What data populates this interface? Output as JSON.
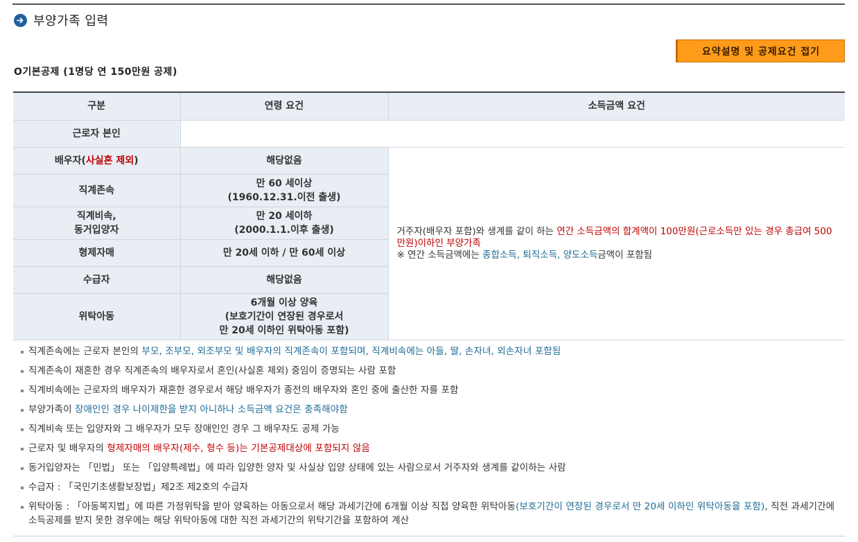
{
  "header": {
    "title": "부양가족 입력",
    "icon": "arrow-circle-icon"
  },
  "fold_button": {
    "label": "요약설명 및 공제요건 접기"
  },
  "section_title": "O기본공제 (1명당 연 150만원 공제)",
  "table": {
    "headers": [
      "구분",
      "연령 요건",
      "소득금액 요건"
    ],
    "rows": [
      {
        "label": "근로자 본인",
        "condition": ""
      },
      {
        "label_a": "배우자(",
        "label_b": "사실혼 제외",
        "label_c": ")",
        "condition": "해당없음"
      },
      {
        "label": "직계존속",
        "condition_1": "만 60 세이상",
        "condition_2": "(1960.12.31.이전 출생)"
      },
      {
        "label_1": "직계비속,",
        "label_2": "동거입양자",
        "condition_1": "만 20 세이하",
        "condition_2": "(2000.1.1.이후 출생)"
      },
      {
        "label": "형제자매",
        "condition": "만 20세 이하 / 만 60세 이상"
      },
      {
        "label": "수급자",
        "condition": "해당없음"
      },
      {
        "label": "위탁아동",
        "condition_1": "6개월 이상 양육",
        "condition_2": "(보호기간이 연장된 경우로서",
        "condition_3": "만 20세 이하인 위탁아동 포함)"
      }
    ],
    "income": {
      "part1": "거주자(배우자 포함)와 생계를 같이 하는 ",
      "part2": "연간 소득금액의 합계액이 100만원(근로소득만 있는 경우 총급여 500만원)이하인 부양가족",
      "part3": "※ 연간 소득금액에는 ",
      "part4": "종합소득, 퇴직소득, 양도소득",
      "part5": "금액이 포함됨"
    }
  },
  "notes": [
    {
      "a": "직계존속에는 근로자 본인의 ",
      "b": "부모, 조부모, 외조부모 및 배우자의 직계존속이 포함되며, 직계비속에는 아들, 딸, 손자녀, 외손자녀 포함됨"
    },
    {
      "a": "직계존속이 재혼한 경우 직계존속의 배우자로서 혼인(사실혼 제외) 중임이 증명되는 사람 포함"
    },
    {
      "a": "직계비속에는 근로자의 배우자가 재혼한 경우로서 해당 배우자가 종전의 배우자와 혼인 중에 출산한 자를 포함"
    },
    {
      "a": "부양가족이 ",
      "b": "장애인인 경우 나이제한을 받지 아니하나 소득금액 요건은 충족해야함"
    },
    {
      "a": "직계비속 또는 입양자와 그 배우자가 모두 장애인인 경우 그 배우자도 공제 가능"
    },
    {
      "a": "근로자 및 배우자의 ",
      "b": "형제자매의 배우자(제수, 형수 등)는 기본공제대상에 포함되지 않음"
    },
    {
      "a": "동거입양자는 「민법」 또는 「입양특례법」에 따라 입양한 양자 및 사실상 입양 상태에 있는 사람으로서 거주자와 생계를 같이하는 사람"
    },
    {
      "a": "수급자 : 「국민기초생활보장법」제2조 제2호의 수급자"
    },
    {
      "a": "위탁아동 : 「아동복지법」에 따른 가정위탁을 받아 양육하는 아동으로서 해당 과세기간에 6개월 이상 직접 양육한 위탁아동",
      "b": "(보호기간이 연장된 경우로서 만 20세 이하인 위탁아동을 포함)",
      "c": ", 직전 과세기간에 소득공제를 받지 못한 경우에는 해당 위탁아동에 대한 직전 과세기간의 위탁기간을 포함하여 계산"
    }
  ],
  "colors": {
    "accent_red": "#c00000",
    "accent_blue": "#1f5a9b",
    "button_orange": "#ff9b1a",
    "header_cell_bg": "#e9edf4"
  }
}
